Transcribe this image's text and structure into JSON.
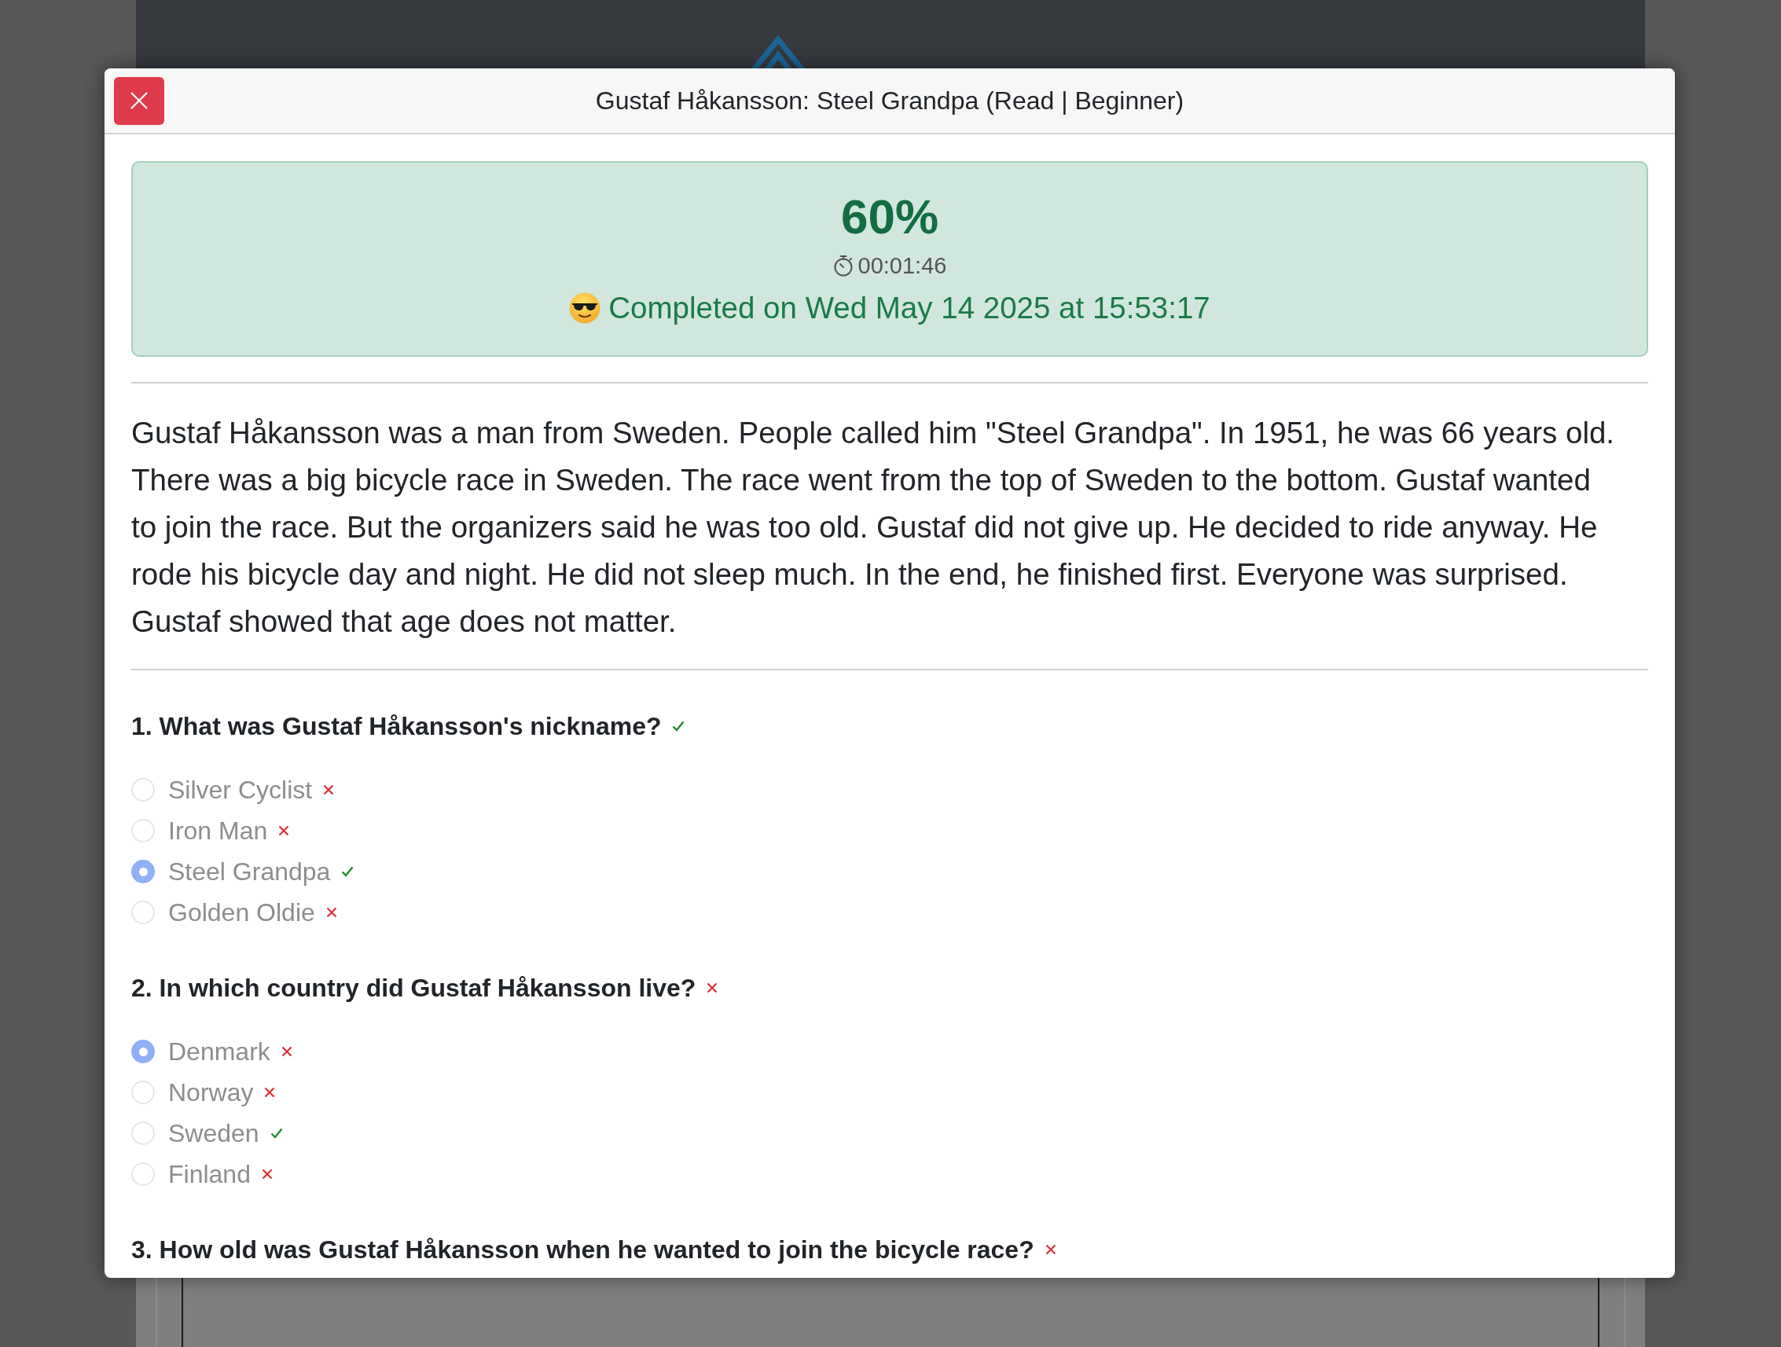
{
  "modal": {
    "title": "Gustaf Håkansson: Steel Grandpa (Read | Beginner)"
  },
  "result": {
    "score": "60%",
    "elapsed_time": "00:01:46",
    "completed": "Completed on Wed May 14 2025 at 15:53:17"
  },
  "passage": "Gustaf Håkansson was a man from Sweden. People called him \"Steel Grandpa\". In 1951, he was 66 years old. There was a big bicycle race in Sweden. The race went from the top of Sweden to the bottom. Gustaf wanted to join the race. But the organizers said he was too old. Gustaf did not give up. He decided to ride anyway. He rode his bicycle day and night. He did not sleep much. In the end, he finished first. Everyone was surprised. Gustaf showed that age does not matter.",
  "questions": [
    {
      "text": "1. What was Gustaf Håkansson's nickname?",
      "correct": true,
      "options": [
        {
          "label": "Silver Cyclist",
          "selected": false,
          "correct": false,
          "disabled": true
        },
        {
          "label": "Iron Man",
          "selected": false,
          "correct": false,
          "disabled": true
        },
        {
          "label": "Steel Grandpa",
          "selected": true,
          "correct": true,
          "disabled": true
        },
        {
          "label": "Golden Oldie",
          "selected": false,
          "correct": false,
          "disabled": true
        }
      ]
    },
    {
      "text": "2. In which country did Gustaf Håkansson live?",
      "correct": false,
      "options": [
        {
          "label": "Denmark",
          "selected": true,
          "correct": false,
          "disabled": true
        },
        {
          "label": "Norway",
          "selected": false,
          "correct": false,
          "disabled": true
        },
        {
          "label": "Sweden",
          "selected": false,
          "correct": true,
          "disabled": true
        },
        {
          "label": "Finland",
          "selected": false,
          "correct": false,
          "disabled": true
        }
      ]
    },
    {
      "text": "3. How old was Gustaf Håkansson when he wanted to join the bicycle race?",
      "correct": false
    }
  ]
}
